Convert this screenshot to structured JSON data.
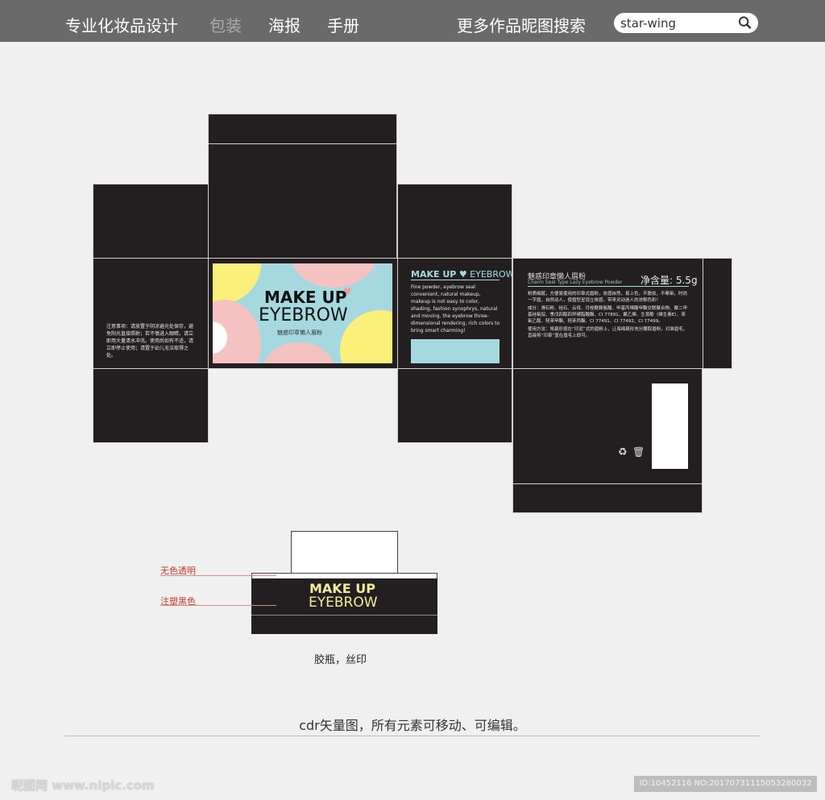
{
  "header": {
    "nav": [
      "专业化妆品设计",
      "包装",
      "海报",
      "手册"
    ],
    "more": "更多作品昵图搜索",
    "search_value": "star-wing"
  },
  "front": {
    "title1": "MAKE UP",
    "title2": "EYEBROW",
    "subtitle": "魅惑印章懒人眉粉"
  },
  "left_side": {
    "notice": "注意事项：请放置于阴凉避光处保存，避免阳光直接照射；若不慎进入眼睛，请立即用大量清水冲洗。使用后如有不适，请立即停止使用；请置于幼儿无法取得之处。"
  },
  "right_side": {
    "title1": "MAKE UP",
    "title2": "EYEBROW",
    "desc": "Fine powder, eyebrow seal convenient, natural makeup, makeup is not easy to color, shading, fashion synophrys, natural and moving, the eyebrow three-dimensional rendering, rich colors to bring smart charming!"
  },
  "back": {
    "name_cn": "魅惑印章懒人眉粉",
    "name_en": "Charm Seal Type Lazy Eyebrow Powder",
    "net": "净含量: 5.5g",
    "p1": "粉质细腻，方便易使用的印章式眉粉，妆感自然，易上色，不脱妆，不晕染，时尚一字眉，自然动人，使眉型呈现立体感，带来灵动迷人的浓郁色彩！",
    "p2": "成分：滑石粉、硅石、云母、月桂酰赖氨酸、甲基丙烯酸甲酯交联聚合物、聚二甲基硅氧烷、季戊四醇四异硬脂酸酯、CI 77891、聚乙烯、生育酚（维生素E）、苯氧乙醇、羟苯甲酯、羟苯丙酯、CI 77491、CI 77492、CI 77499。",
    "p3": "使用方法：将扁形按在“印泥”式的眉粉上，让海绵扁形充分蘸取眉粉，对准眉毛，直接将“印章”盖在眉毛上即可。"
  },
  "jar": {
    "label_clear": "无色透明",
    "label_black": "注塑黑色",
    "title1": "MAKE UP",
    "title2": "EYEBROW",
    "caption": "胶瓶，丝印"
  },
  "note": "cdr矢量图，所有元素可移动、可编辑。",
  "footer": {
    "logo": "昵图网 www.nipic.com",
    "id": "ID:10452116 NO:20170731115053280032"
  },
  "colors": {
    "panel": "#231f20",
    "header": "#6a6a6a",
    "accent": "#a6d9df"
  }
}
